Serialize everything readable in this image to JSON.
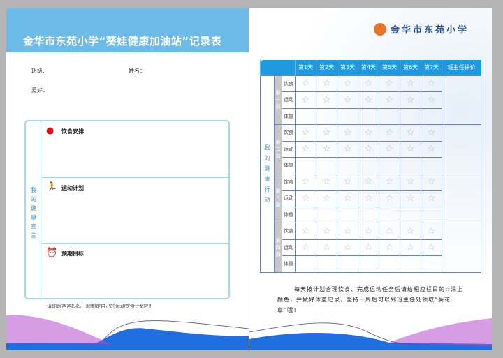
{
  "left": {
    "title": "金华市东苑小学“葵娃健康加油站”记录表",
    "class_label": "班级:",
    "name_label": "姓名：",
    "hobby_label": "爱好：",
    "side_label": "我的健康宣言",
    "sections": [
      {
        "icon": "apple-icon",
        "label": "饮食安排"
      },
      {
        "icon": "runner-icon",
        "label": "运动计划"
      },
      {
        "icon": "alarm-clock-icon",
        "label": "预期目标"
      }
    ],
    "note": "请你跟爸爸妈妈一起制定自己的运动饮食计划吧！"
  },
  "right": {
    "logo": "金华市东苑小学",
    "table": {
      "headers": [
        "第1天",
        "第2天",
        "第3天",
        "第4天",
        "第5天",
        "第6天",
        "第7天",
        "班主任评价"
      ],
      "side_label": "我的健康行动",
      "weeks": [
        "第一周",
        "第二周",
        "第三周",
        "第四周"
      ],
      "rows": [
        "饮食",
        "运动",
        "体重"
      ]
    },
    "instruction": "每天按计划合理饮食、完成运动任务后请给相应栏目的☆涂上颜色，并做好体重记录，坚持一周后可以到班主任处领取“葵花章”哦！"
  },
  "colors": {
    "header_blue": "#1e9ae0",
    "band_blue": "#6dbbe8",
    "logo_orange": "#e8742a"
  }
}
